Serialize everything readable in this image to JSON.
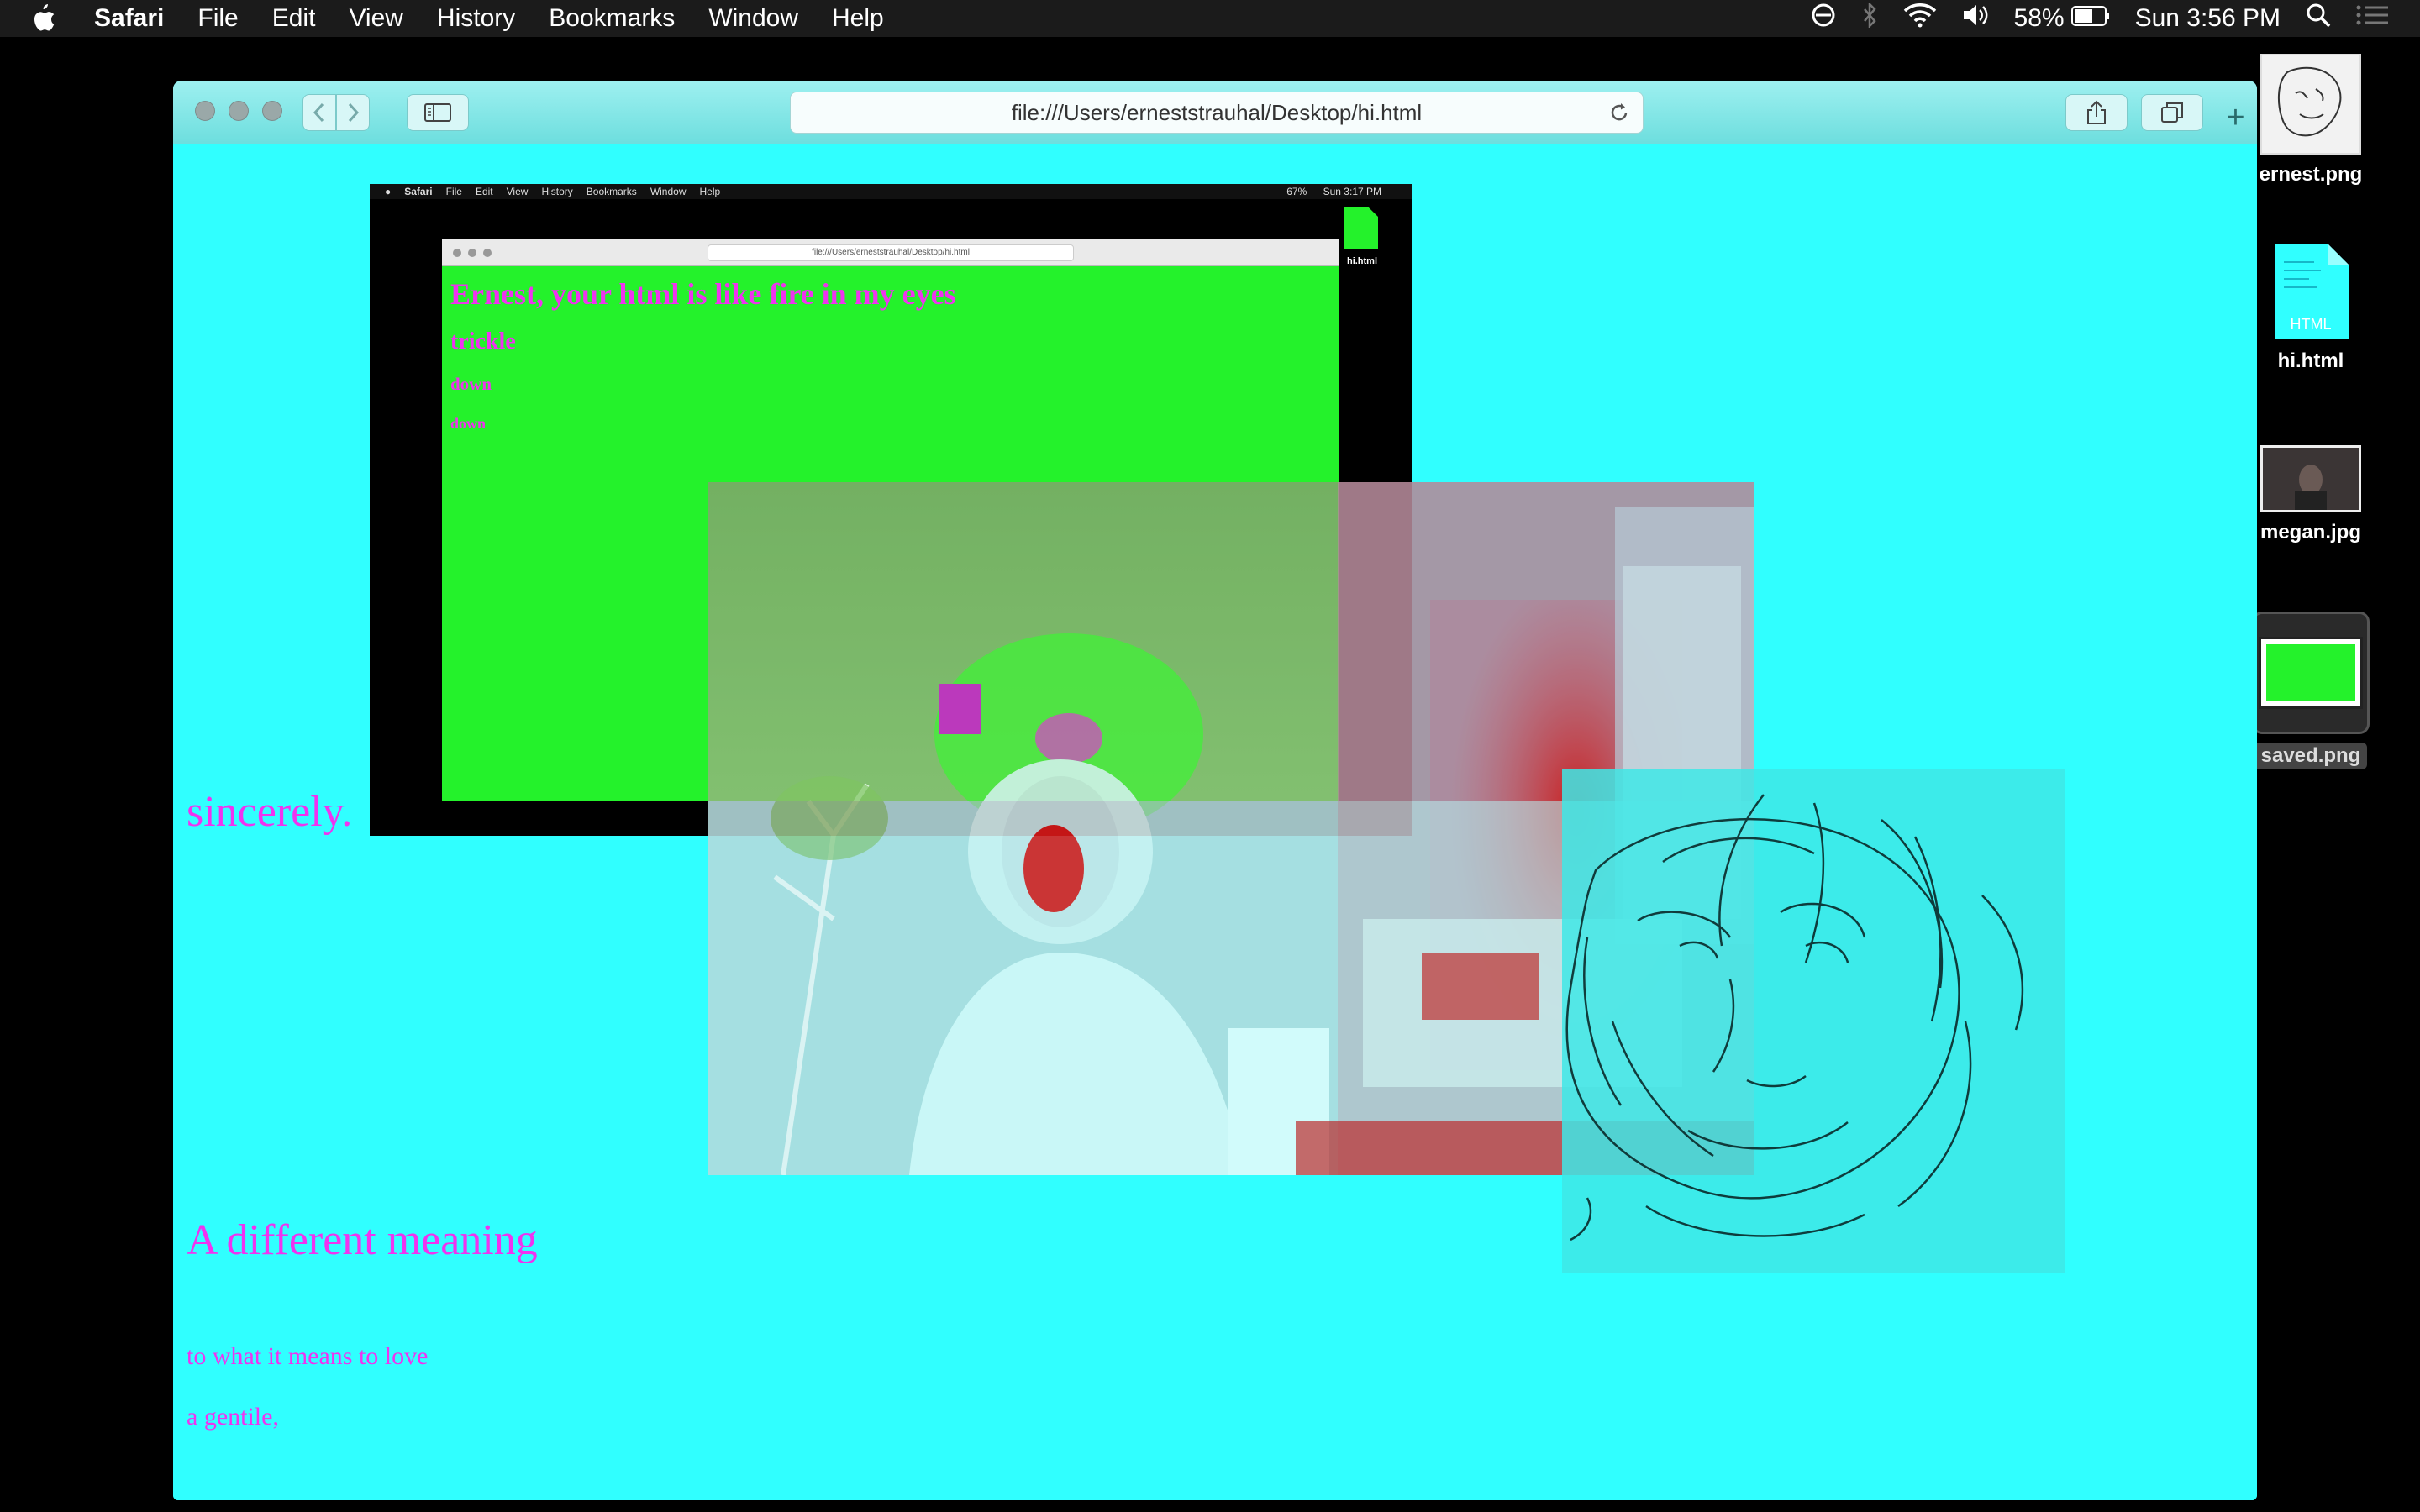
{
  "menubar": {
    "app_name": "Safari",
    "menus": [
      "File",
      "Edit",
      "View",
      "History",
      "Bookmarks",
      "Window",
      "Help"
    ],
    "battery_percent": "58%",
    "clock": "Sun 3:56 PM",
    "icons": [
      "apple-icon",
      "do-not-disturb-icon",
      "bluetooth-icon",
      "wifi-icon",
      "volume-icon",
      "battery-icon",
      "spotlight-search-icon",
      "notification-center-icon"
    ]
  },
  "desktop": {
    "icons": [
      {
        "label": "ernest.png"
      },
      {
        "label": "hi.html",
        "badge": "HTML"
      },
      {
        "label": "megan.jpg"
      },
      {
        "label": "saved.png"
      }
    ]
  },
  "safari": {
    "url": "file:///Users/erneststrauhal/Desktop/hi.html",
    "colors": {
      "page_background": "#30ffff",
      "text": "#ef33ef"
    }
  },
  "page": {
    "sincerely": "sincerely.",
    "different_meaning": "A different meaning",
    "to_what_it_means": "to what it means to love",
    "gentile": "a gentile,"
  },
  "nested_screenshot": {
    "menubar": {
      "app_name": "Safari",
      "menus": [
        "File",
        "Edit",
        "View",
        "History",
        "Bookmarks",
        "Window",
        "Help"
      ],
      "battery_percent": "67%",
      "clock": "Sun 3:17 PM"
    },
    "url": "file:///Users/erneststrauhal/Desktop/hi.html",
    "heading1": "Ernest, your html is like fire in my eyes",
    "heading2": "trickle",
    "heading3": "down",
    "heading4": "down",
    "file_label": "hi.html",
    "colors": {
      "page_background": "#24f22b"
    }
  }
}
